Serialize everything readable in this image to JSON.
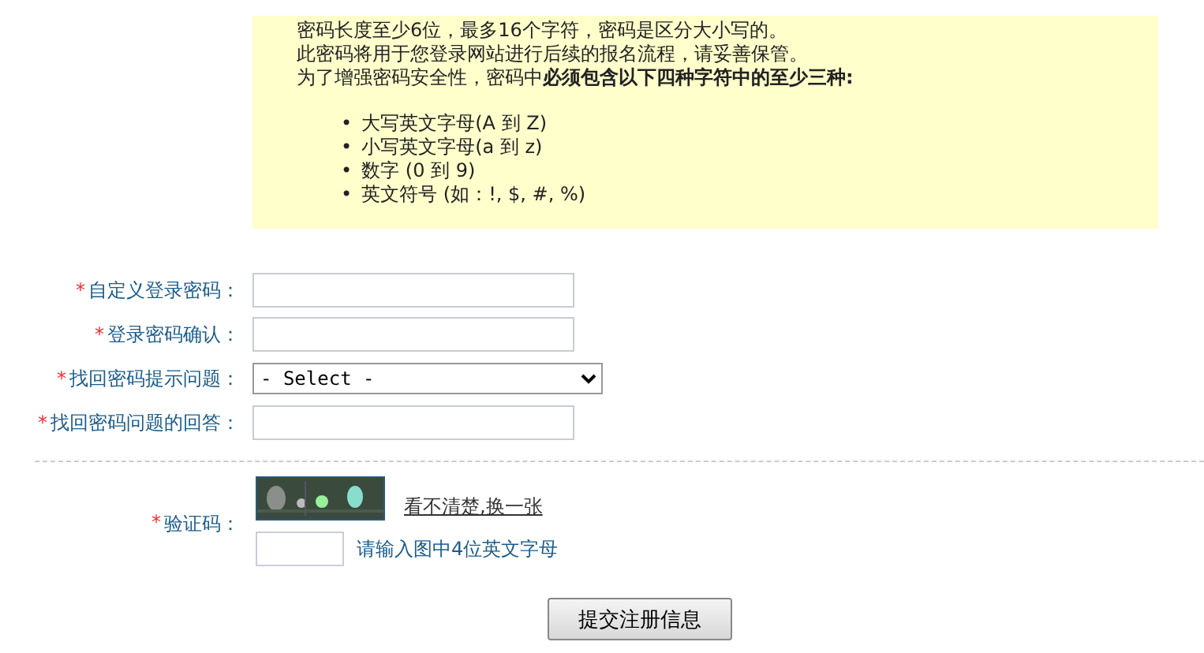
{
  "notice": {
    "lines": [
      "密码长度至少6位，最多16个字符，密码是区分大小写的。",
      "此密码将用于您登录网站进行后续的报名流程，请妥善保管。",
      "为了增强密码安全性，密码中**必须包含以下四种字符中的至少三种:**"
    ],
    "items": [
      {
        "marker": "•",
        "text": "大写英文字母(A 到 Z)"
      },
      {
        "marker": "•",
        "text": "小写英文字母(a 到 z)"
      },
      {
        "marker": "•",
        "text": "数字 (0 到 9)"
      },
      {
        "marker": "•",
        "text": "英文符号 (如：!, $, #, %)"
      }
    ]
  },
  "fields": [
    {
      "kind": "text",
      "required": "*",
      "label": "自定义登录密码："
    },
    {
      "kind": "text",
      "required": "*",
      "label": "登录密码确认："
    },
    {
      "kind": "select",
      "required": "*",
      "label": "找回密码提示问题：",
      "value": "- Select -"
    },
    {
      "kind": "text",
      "required": "*",
      "label": "找回密码问题的回答："
    }
  ],
  "captcha": {
    "required": "*",
    "label": "验证码：",
    "refresh_link": "看不清楚,换一张",
    "hint": "请输入图中4位英文字母"
  },
  "submit": "提交注册信息"
}
